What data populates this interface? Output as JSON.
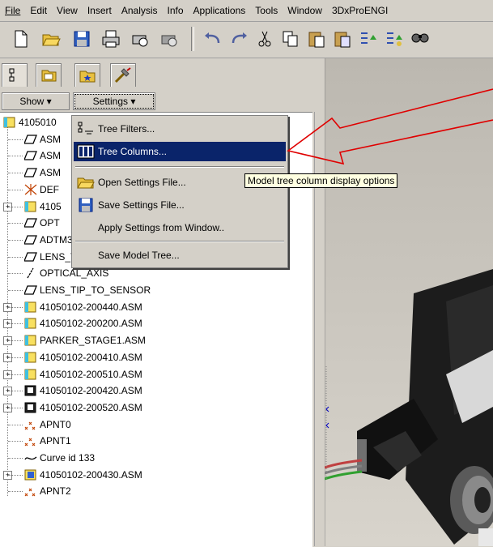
{
  "menubar": {
    "items": [
      {
        "label": "File"
      },
      {
        "label": "Edit"
      },
      {
        "label": "View"
      },
      {
        "label": "Insert"
      },
      {
        "label": "Analysis"
      },
      {
        "label": "Info"
      },
      {
        "label": "Applications"
      },
      {
        "label": "Tools"
      },
      {
        "label": "Window"
      },
      {
        "label": "3DxProENGI"
      }
    ]
  },
  "navigator": {
    "show_label": "Show ▾",
    "settings_label": "Settings ▾"
  },
  "settings_menu": {
    "items": [
      {
        "label": "Tree Filters..."
      },
      {
        "label": "Tree Columns..."
      },
      {
        "label": "Open Settings File..."
      },
      {
        "label": "Save Settings File..."
      },
      {
        "label": "Apply Settings from Window.."
      },
      {
        "label": "Save Model Tree..."
      }
    ]
  },
  "tooltip": {
    "text": "Model tree column display options"
  },
  "tree": {
    "items": [
      {
        "label": "4105010",
        "icon": "assembly"
      },
      {
        "label": "ASM",
        "icon": "datum-plane"
      },
      {
        "label": "ASM",
        "icon": "datum-plane"
      },
      {
        "label": "ASM",
        "icon": "datum-plane"
      },
      {
        "label": "DEF",
        "icon": "csys"
      },
      {
        "label": "4105",
        "icon": "assembly"
      },
      {
        "label": "OPT",
        "icon": "datum-plane"
      },
      {
        "label": "ADTM3",
        "icon": "datum-plane"
      },
      {
        "label": "LENS_TIP",
        "icon": "datum-plane"
      },
      {
        "label": "OPTICAL_AXIS",
        "icon": "datum-axis"
      },
      {
        "label": "LENS_TIP_TO_SENSOR",
        "icon": "datum-plane"
      },
      {
        "label": "41050102-200440.ASM",
        "icon": "assembly"
      },
      {
        "label": "41050102-200200.ASM",
        "icon": "assembly"
      },
      {
        "label": "PARKER_STAGE1.ASM",
        "icon": "assembly"
      },
      {
        "label": "41050102-200410.ASM",
        "icon": "assembly"
      },
      {
        "label": "41050102-200510.ASM",
        "icon": "assembly"
      },
      {
        "label": "41050102-200420.ASM",
        "icon": "part-dark"
      },
      {
        "label": "41050102-200520.ASM",
        "icon": "part-dark"
      },
      {
        "label": "APNT0",
        "icon": "datum-point"
      },
      {
        "label": "APNT1",
        "icon": "datum-point"
      },
      {
        "label": "Curve id 133",
        "icon": "curve"
      },
      {
        "label": "41050102-200430.ASM",
        "icon": "assembly-blue"
      },
      {
        "label": "APNT2",
        "icon": "datum-point"
      }
    ]
  },
  "colors": {
    "highlight": "#0a246a",
    "annotation": "#e00000",
    "tooltip_bg": "#ffffe1"
  }
}
